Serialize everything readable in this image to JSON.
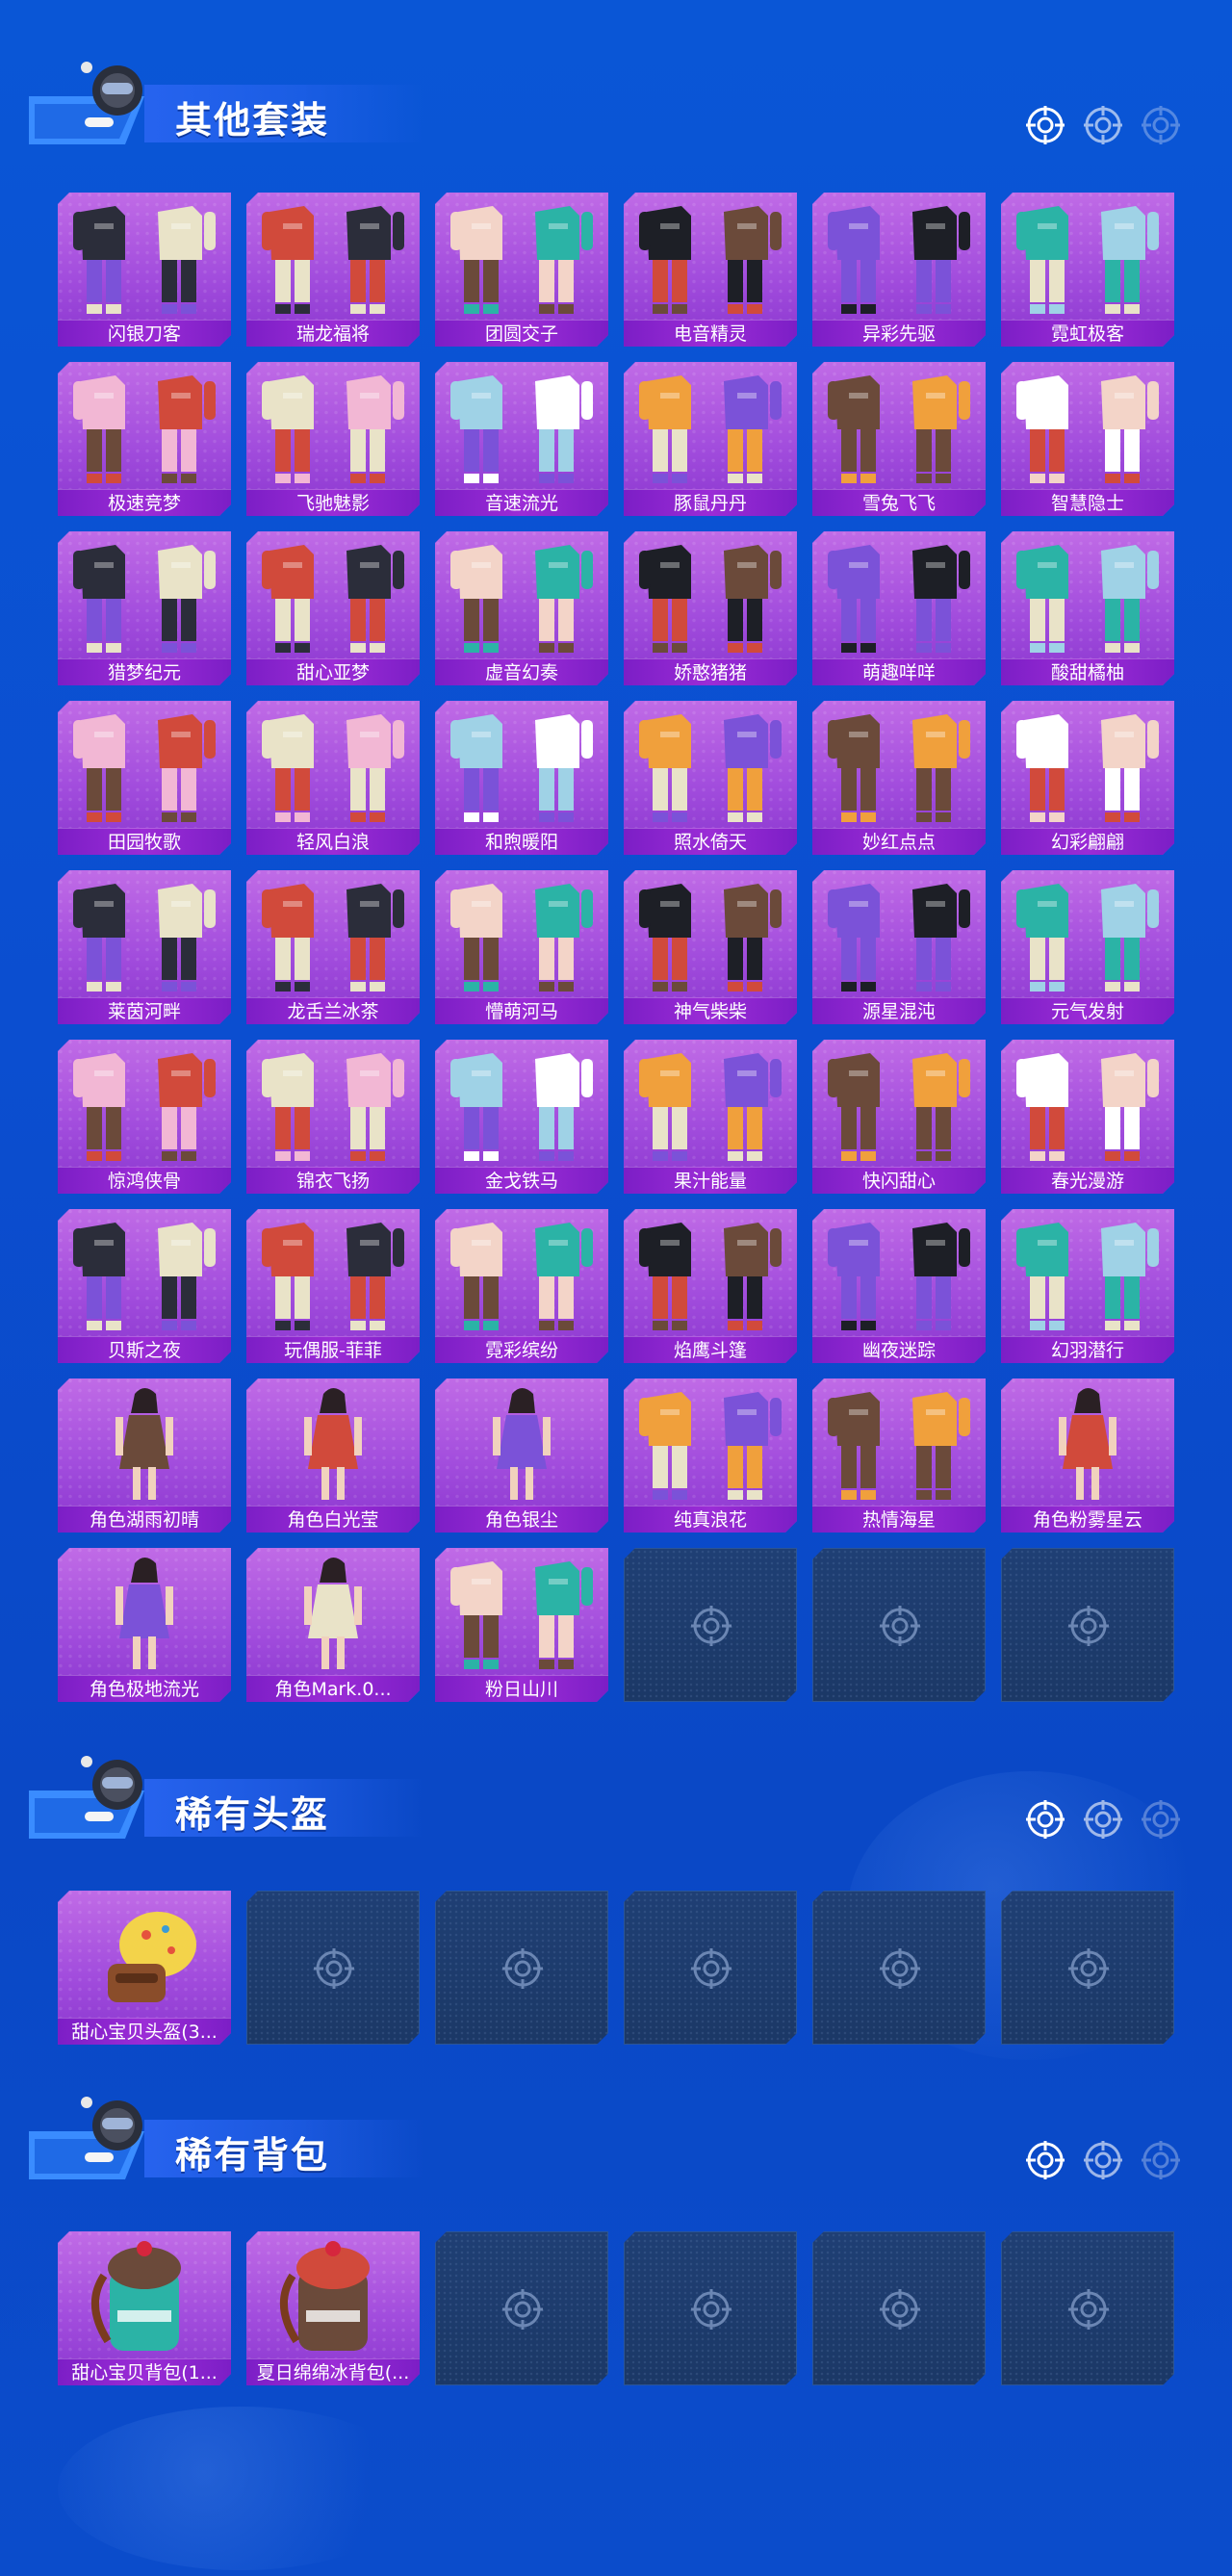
{
  "colors": {
    "page_bg": "#0a56d6",
    "card_bg": "#a24ddd",
    "card_label_bg": "#9b2cd6",
    "empty_card_bg": "#1f3f74",
    "title_text": "#ffffff"
  },
  "sections": [
    {
      "title": "其他套装",
      "icons": [
        "target-icon",
        "target-icon",
        "target-icon"
      ],
      "items": [
        {
          "name": "闪银刀客",
          "icon": "outfit-icon"
        },
        {
          "name": "瑞龙福将",
          "icon": "outfit-icon"
        },
        {
          "name": "团圆交子",
          "icon": "outfit-icon"
        },
        {
          "name": "电音精灵",
          "icon": "outfit-icon"
        },
        {
          "name": "异彩先驱",
          "icon": "outfit-icon"
        },
        {
          "name": "霓虹极客",
          "icon": "outfit-icon"
        },
        {
          "name": "极速竞梦",
          "icon": "outfit-icon"
        },
        {
          "name": "飞驰魅影",
          "icon": "outfit-icon"
        },
        {
          "name": "音速流光",
          "icon": "outfit-icon"
        },
        {
          "name": "豚鼠丹丹",
          "icon": "outfit-icon"
        },
        {
          "name": "雪兔飞飞",
          "icon": "outfit-icon"
        },
        {
          "name": "智慧隐士",
          "icon": "outfit-icon"
        },
        {
          "name": "猎梦纪元",
          "icon": "outfit-icon"
        },
        {
          "name": "甜心亚梦",
          "icon": "outfit-icon"
        },
        {
          "name": "虚音幻奏",
          "icon": "outfit-icon"
        },
        {
          "name": "娇憨猪猪",
          "icon": "outfit-icon"
        },
        {
          "name": "萌趣咩咩",
          "icon": "outfit-icon"
        },
        {
          "name": "酸甜橘柚",
          "icon": "outfit-icon"
        },
        {
          "name": "田园牧歌",
          "icon": "outfit-icon"
        },
        {
          "name": "轻风白浪",
          "icon": "outfit-icon"
        },
        {
          "name": "和煦暖阳",
          "icon": "outfit-icon"
        },
        {
          "name": "照水倚天",
          "icon": "outfit-icon"
        },
        {
          "name": "妙红点点",
          "icon": "outfit-icon"
        },
        {
          "name": "幻彩翩翩",
          "icon": "outfit-icon"
        },
        {
          "name": "莱茵河畔",
          "icon": "outfit-icon"
        },
        {
          "name": "龙舌兰冰茶",
          "icon": "outfit-icon"
        },
        {
          "name": "懵萌河马",
          "icon": "outfit-icon"
        },
        {
          "name": "神气柴柴",
          "icon": "outfit-icon"
        },
        {
          "name": "源星混沌",
          "icon": "outfit-icon"
        },
        {
          "name": "元气发射",
          "icon": "outfit-icon"
        },
        {
          "name": "惊鸿侠骨",
          "icon": "outfit-icon"
        },
        {
          "name": "锦衣飞扬",
          "icon": "outfit-icon"
        },
        {
          "name": "金戈铁马",
          "icon": "outfit-icon"
        },
        {
          "name": "果汁能量",
          "icon": "outfit-icon"
        },
        {
          "name": "快闪甜心",
          "icon": "outfit-icon"
        },
        {
          "name": "春光漫游",
          "icon": "outfit-icon"
        },
        {
          "name": "贝斯之夜",
          "icon": "outfit-icon"
        },
        {
          "name": "玩偶服-菲菲",
          "icon": "outfit-icon"
        },
        {
          "name": "霓彩缤纷",
          "icon": "outfit-icon"
        },
        {
          "name": "焰鹰斗篷",
          "icon": "outfit-icon"
        },
        {
          "name": "幽夜迷踪",
          "icon": "outfit-icon"
        },
        {
          "name": "幻羽潜行",
          "icon": "outfit-icon"
        },
        {
          "name": "角色湖雨初晴",
          "icon": "character-icon"
        },
        {
          "name": "角色白光莹",
          "icon": "character-icon"
        },
        {
          "name": "角色银尘",
          "icon": "character-icon"
        },
        {
          "name": "纯真浪花",
          "icon": "outfit-icon"
        },
        {
          "name": "热情海星",
          "icon": "outfit-icon"
        },
        {
          "name": "角色粉雾星云",
          "icon": "character-icon"
        },
        {
          "name": "角色极地流光",
          "icon": "character-icon"
        },
        {
          "name": "角色Mark.0...",
          "icon": "character-icon"
        },
        {
          "name": "粉日山川",
          "icon": "outfit-icon"
        }
      ],
      "empty_slots": 3
    },
    {
      "title": "稀有头盔",
      "icons": [
        "target-icon",
        "target-icon",
        "target-icon"
      ],
      "items": [
        {
          "name": "甜心宝贝头盔(3...",
          "icon": "helmet-icon"
        }
      ],
      "empty_slots": 5
    },
    {
      "title": "稀有背包",
      "icons": [
        "target-icon",
        "target-icon",
        "target-icon"
      ],
      "items": [
        {
          "name": "甜心宝贝背包(1...",
          "icon": "backpack-icon"
        },
        {
          "name": "夏日绵绵冰背包(...",
          "icon": "backpack-icon"
        }
      ],
      "empty_slots": 4
    }
  ]
}
